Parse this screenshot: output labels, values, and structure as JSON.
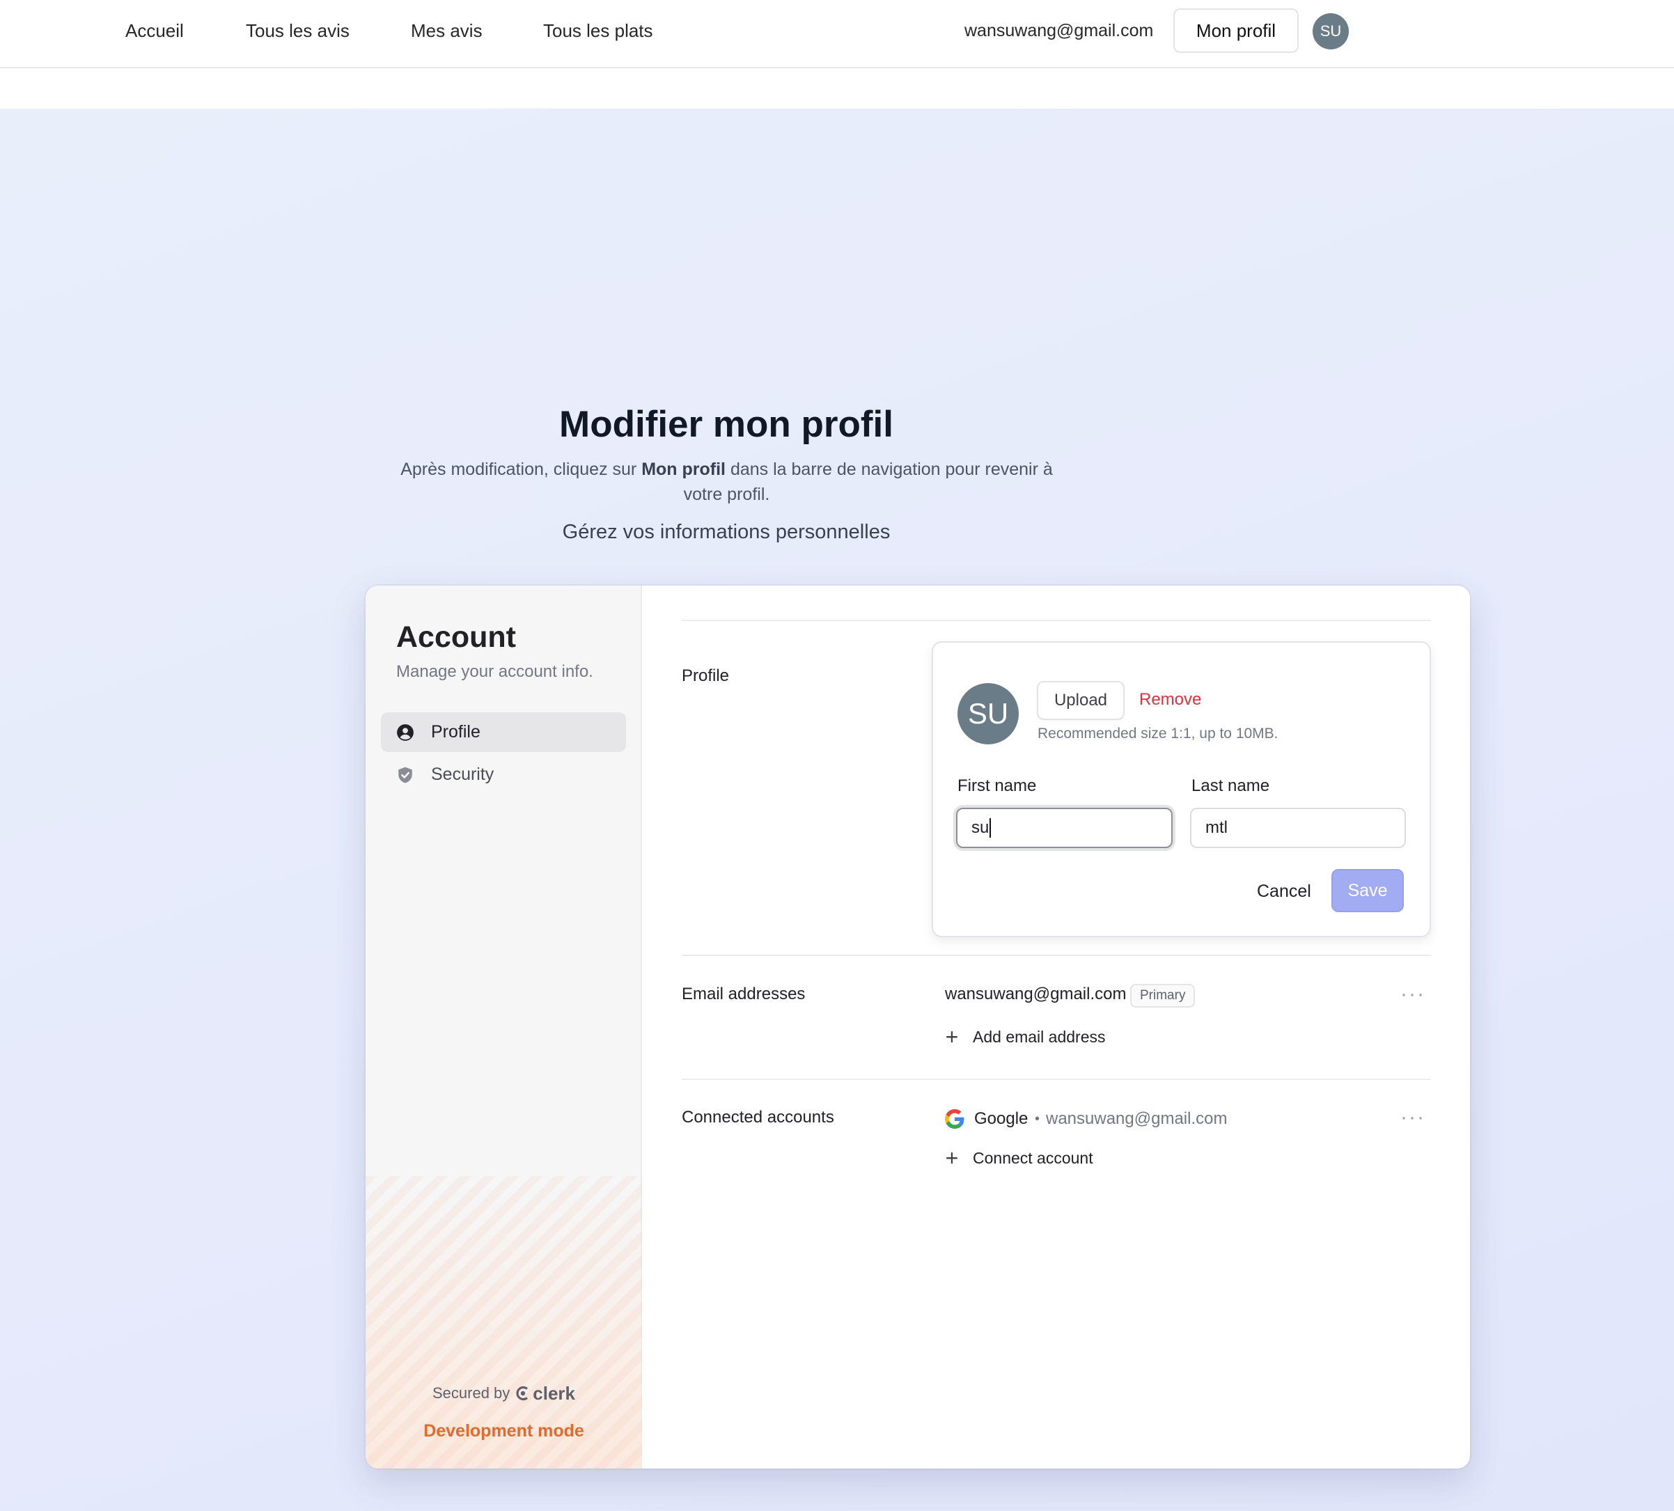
{
  "nav": {
    "links": [
      "Accueil",
      "Tous les avis",
      "Mes avis",
      "Tous les plats"
    ],
    "email": "wansuwang@gmail.com",
    "profile_button": "Mon profil",
    "avatar_initials": "SU"
  },
  "page": {
    "title": "Modifier mon profil",
    "subtitle_before": "Après modification, cliquez sur ",
    "subtitle_bold": "Mon profil",
    "subtitle_after": " dans la barre de navigation pour revenir à votre profil.",
    "tagline": "Gérez vos informations personnelles"
  },
  "sidebar": {
    "title": "Account",
    "subtitle": "Manage your account info.",
    "items": [
      {
        "label": "Profile",
        "icon": "user-circle-icon",
        "active": true
      },
      {
        "label": "Security",
        "icon": "shield-check-icon",
        "active": false
      }
    ],
    "secured_by": "Secured by",
    "brand": "clerk",
    "dev_mode": "Development mode"
  },
  "profile": {
    "section_label": "Profile",
    "avatar_initials": "SU",
    "upload_label": "Upload",
    "remove_label": "Remove",
    "hint": "Recommended size 1:1, up to 10MB.",
    "first_name_label": "First name",
    "first_name_value": "su",
    "last_name_label": "Last name",
    "last_name_value": "mtl",
    "cancel_label": "Cancel",
    "save_label": "Save"
  },
  "emails": {
    "section_label": "Email addresses",
    "address": "wansuwang@gmail.com",
    "badge": "Primary",
    "add_label": "Add email address"
  },
  "connected": {
    "section_label": "Connected accounts",
    "provider": "Google",
    "separator": "•",
    "account_email": "wansuwang@gmail.com",
    "connect_label": "Connect account"
  },
  "colors": {
    "accent": "#a2acf2",
    "danger": "#e0303d",
    "dev_mode": "#e06b2d",
    "avatar": "#6b7c89"
  }
}
